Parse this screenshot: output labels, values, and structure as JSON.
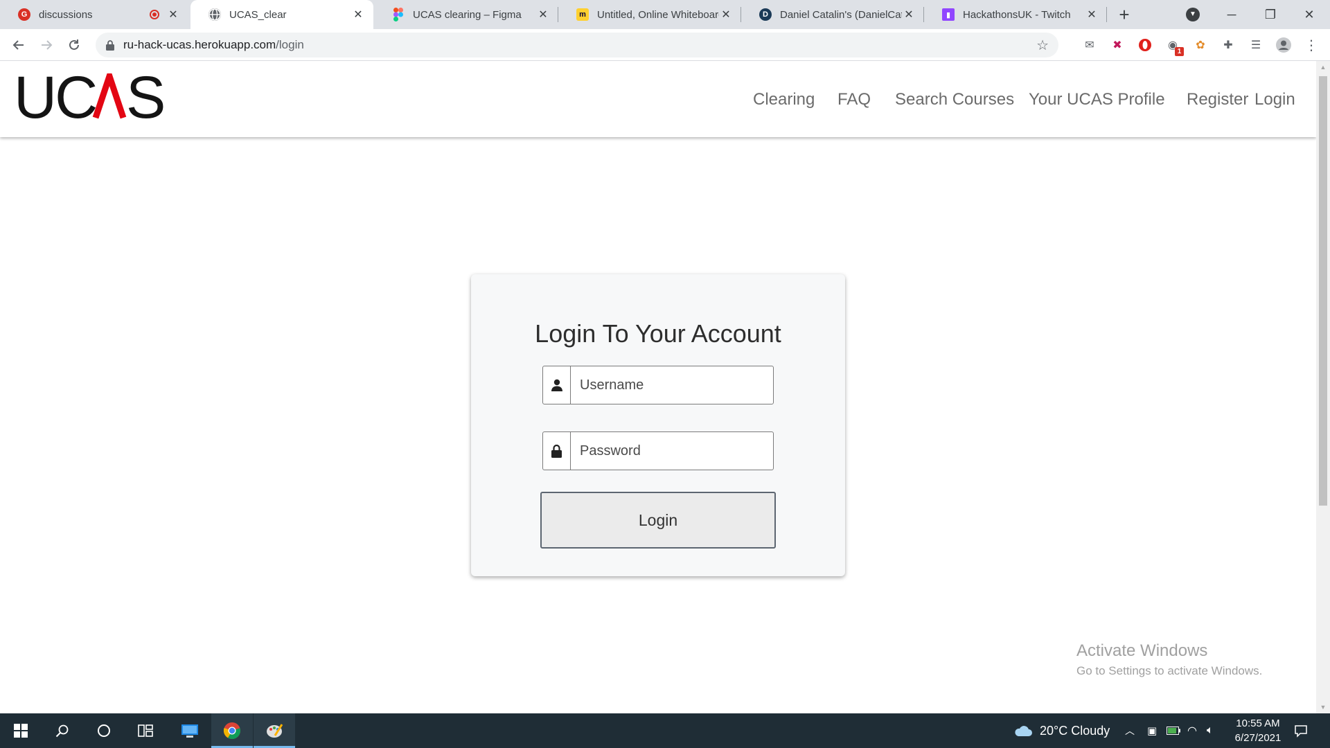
{
  "browser": {
    "tabs": [
      {
        "title": "discussions",
        "favicon": "hangouts-icon",
        "color": "#d93025",
        "recording": true
      },
      {
        "title": "UCAS_clear",
        "favicon": "globe-icon",
        "color": "#5f6368",
        "active": true
      },
      {
        "title": "UCAS clearing – Figma",
        "favicon": "figma-icon",
        "color": "#f24e1e"
      },
      {
        "title": "Untitled, Online Whiteboard",
        "favicon": "miro-icon",
        "color": "#ffd02f"
      },
      {
        "title": "Daniel Catalin's (DanielCatalin",
        "favicon": "d-icon",
        "color": "#1b3a57"
      },
      {
        "title": "HackathonsUK - Twitch",
        "favicon": "twitch-icon",
        "color": "#9146ff"
      }
    ],
    "new_tab_symbol": "+",
    "url_host": "ru-hack-ucas.herokuapp.com",
    "url_path": "/login",
    "extension_badge": "1"
  },
  "site": {
    "logo_text": "UCAS",
    "logo_dark": "#141414",
    "logo_accent": "#e30613",
    "nav": {
      "clearing": "Clearing",
      "faq": "FAQ",
      "search_courses": "Search Courses",
      "profile": "Your UCAS Profile",
      "register": "Register",
      "login": "Login"
    }
  },
  "login_form": {
    "title": "Login To Your Account",
    "username_placeholder": "Username",
    "password_placeholder": "Password",
    "submit_label": "Login"
  },
  "watermark": {
    "line1": "Activate Windows",
    "line2": "Go to Settings to activate Windows."
  },
  "taskbar": {
    "weather": "20°C  Cloudy",
    "time": "10:55 AM",
    "date": "6/27/2021"
  }
}
